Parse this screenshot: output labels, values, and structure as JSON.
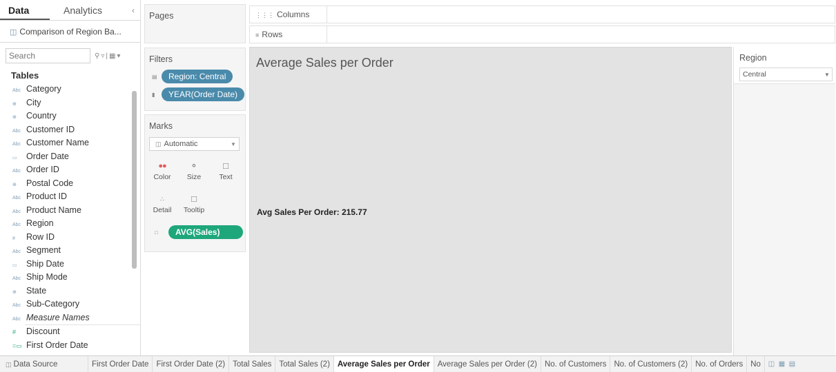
{
  "left_pane": {
    "tabs": [
      {
        "label": "Data"
      },
      {
        "label": "Analytics"
      }
    ],
    "collapse_glyph": "‹",
    "datasource": "Comparison of Region Ba...",
    "search_placeholder": "Search",
    "tables_title": "Tables",
    "dimensions": [
      {
        "type": "Abc",
        "label": "Category"
      },
      {
        "type": "⊕",
        "label": "City"
      },
      {
        "type": "⊕",
        "label": "Country"
      },
      {
        "type": "Abc",
        "label": "Customer ID"
      },
      {
        "type": "Abc",
        "label": "Customer Name"
      },
      {
        "type": "▭",
        "label": "Order Date"
      },
      {
        "type": "Abc",
        "label": "Order ID"
      },
      {
        "type": "⊕",
        "label": "Postal Code"
      },
      {
        "type": "Abc",
        "label": "Product ID"
      },
      {
        "type": "Abc",
        "label": "Product Name"
      },
      {
        "type": "Abc",
        "label": "Region"
      },
      {
        "type": "#",
        "label": "Row ID"
      },
      {
        "type": "Abc",
        "label": "Segment"
      },
      {
        "type": "▭",
        "label": "Ship Date"
      },
      {
        "type": "Abc",
        "label": "Ship Mode"
      },
      {
        "type": "⊕",
        "label": "State"
      },
      {
        "type": "Abc",
        "label": "Sub-Category"
      },
      {
        "type": "Abc",
        "label": "Measure Names"
      }
    ],
    "measures": [
      {
        "type": "#",
        "label": "Discount"
      },
      {
        "type": "=▭",
        "label": "First Order Date"
      }
    ]
  },
  "pages": {
    "title": "Pages"
  },
  "filters": {
    "title": "Filters",
    "pills": [
      "Region: Central",
      "YEAR(Order Date)"
    ]
  },
  "marks": {
    "title": "Marks",
    "type": "Automatic",
    "buttons": [
      {
        "label": "Color",
        "icon": "color-dots-icon"
      },
      {
        "label": "Size",
        "icon": "size-icon"
      },
      {
        "label": "Text",
        "icon": "text-icon"
      },
      {
        "label": "Detail",
        "icon": "detail-icon"
      },
      {
        "label": "Tooltip",
        "icon": "tooltip-icon"
      }
    ],
    "pill": "AVG(Sales)"
  },
  "shelves": {
    "columns": "Columns",
    "rows": "Rows"
  },
  "view": {
    "title": "Average Sales per Order",
    "label": "Avg Sales Per Order: 215.77"
  },
  "region_filter": {
    "title": "Region",
    "value": "Central"
  },
  "tabs": {
    "data_source": "Data Source",
    "sheets": [
      "First Order Date",
      "First Order Date (2)",
      "Total Sales",
      "Total Sales (2)",
      "Average Sales per Order",
      "Average Sales per Order (2)",
      "No. of Customers",
      "No. of Customers (2)",
      "No. of Orders",
      "No"
    ],
    "active_index": 4
  }
}
